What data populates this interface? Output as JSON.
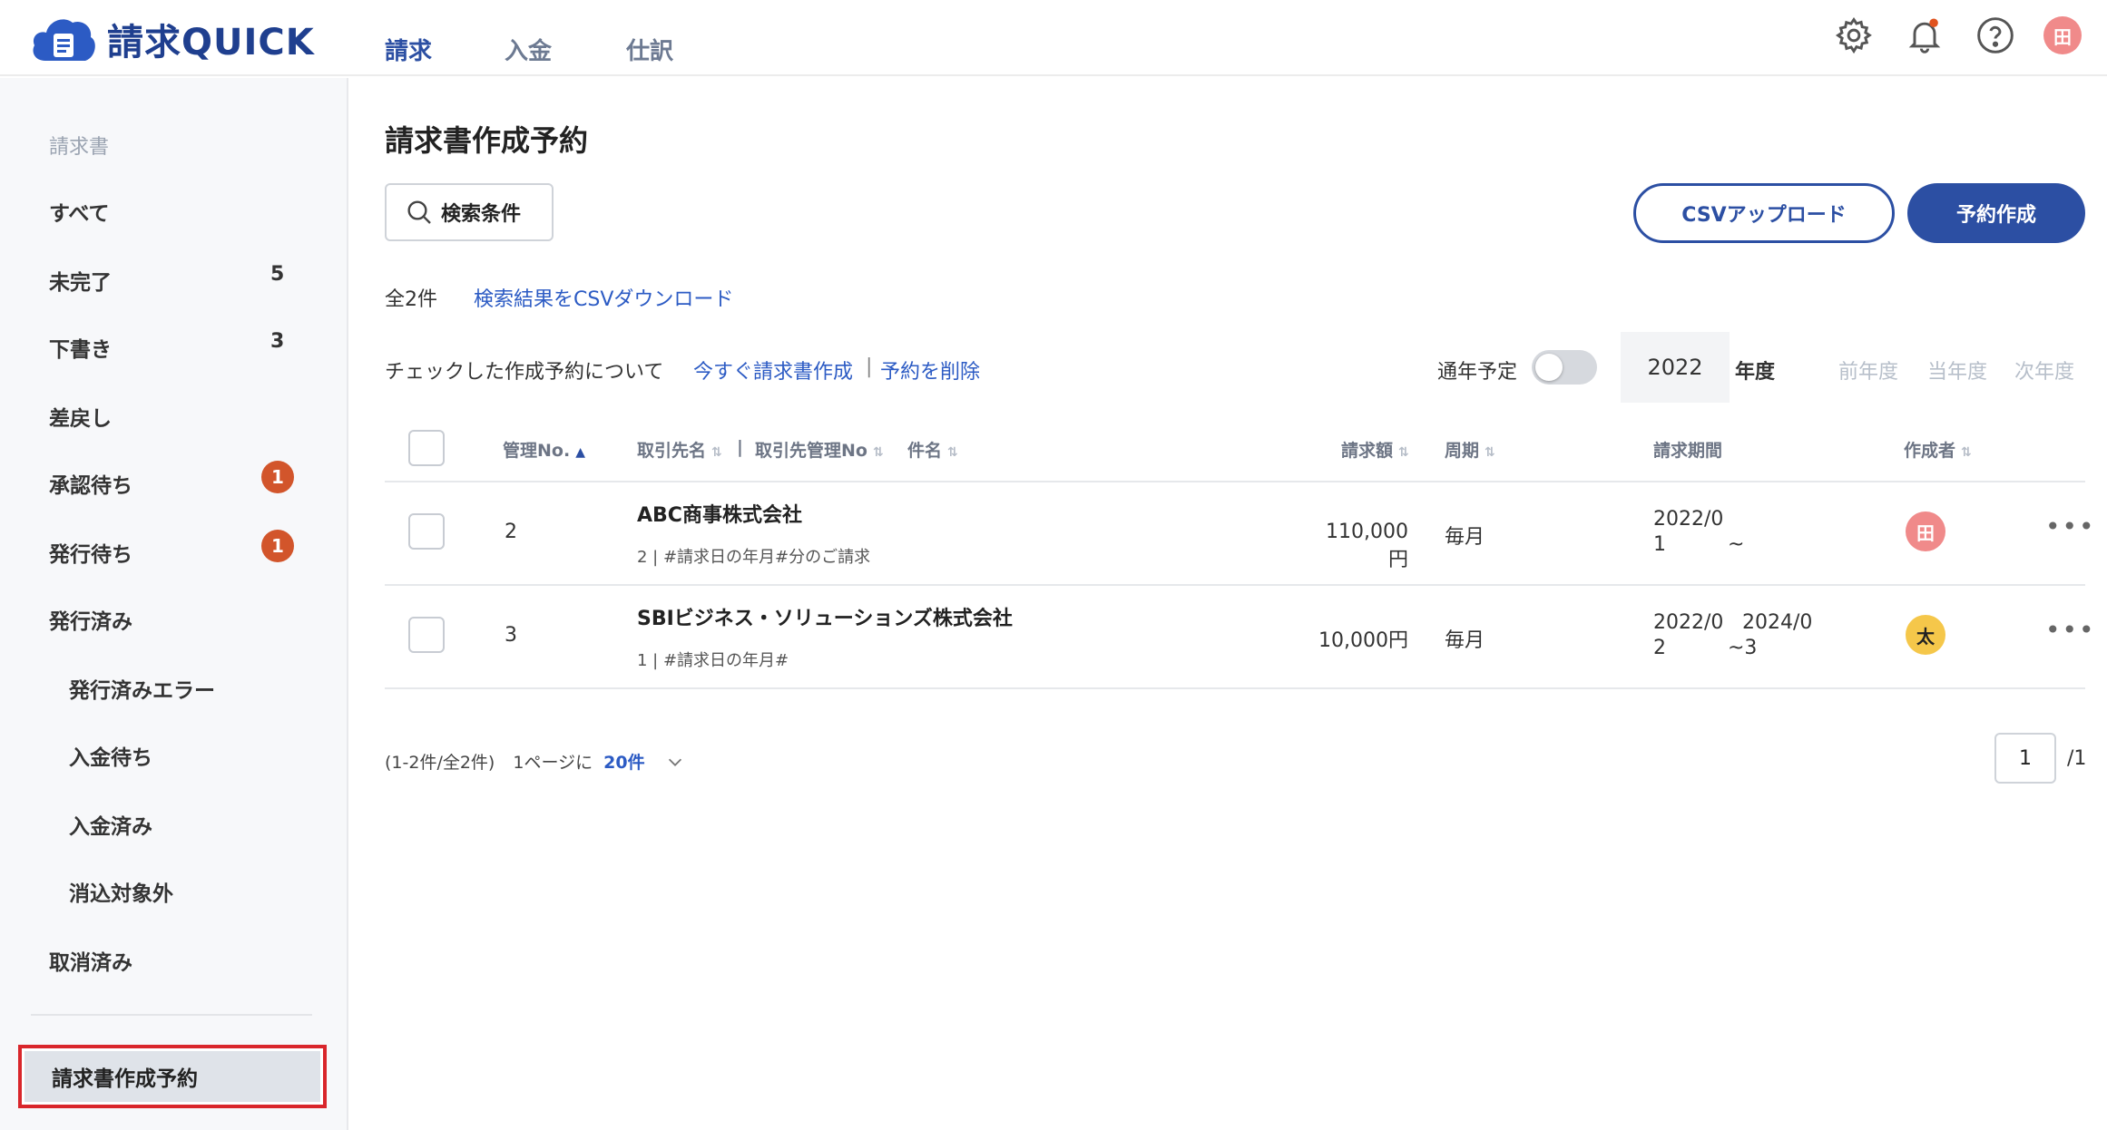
{
  "app": {
    "name": "請求QUICK"
  },
  "nav": {
    "tabs": [
      "請求",
      "入金",
      "仕訳"
    ],
    "active": 0
  },
  "header": {
    "user_initial": "田"
  },
  "sidebar": {
    "heading": "請求書",
    "items": [
      {
        "label": "すべて"
      },
      {
        "label": "未完了",
        "count": "5"
      },
      {
        "label": "下書き",
        "count": "3"
      },
      {
        "label": "差戻し"
      },
      {
        "label": "承認待ち",
        "badge": "1"
      },
      {
        "label": "発行待ち",
        "badge": "1"
      },
      {
        "label": "発行済み"
      }
    ],
    "subitems": [
      {
        "label": "発行済みエラー"
      },
      {
        "label": "入金待ち"
      },
      {
        "label": "入金済み"
      },
      {
        "label": "消込対象外"
      }
    ],
    "after_sub": {
      "label": "取消済み"
    },
    "active_item": {
      "label": "請求書作成予約"
    }
  },
  "main": {
    "title": "請求書作成予約",
    "search_label": "検索条件",
    "csv_upload": "CSVアップロード",
    "create_button": "予約作成",
    "count_text": "全2件",
    "csv_download": "検索結果をCSVダウンロード",
    "bulk_label": "チェックした作成予約について",
    "bulk_create": "今すぐ請求書作成",
    "bulk_sep": "|",
    "bulk_delete": "予約を削除",
    "yearly_label": "通年予定",
    "year": "2022",
    "year_suffix": "年度",
    "prev_year": "前年度",
    "current_year": "当年度",
    "next_year": "次年度"
  },
  "table": {
    "headers": {
      "no": "管理No.",
      "client": "取引先名",
      "sep": "|",
      "client_no": "取引先管理No",
      "subject": "件名",
      "amount": "請求額",
      "cycle": "周期",
      "period": "請求期間",
      "author": "作成者"
    },
    "rows": [
      {
        "no": "2",
        "client": "ABC商事株式会社",
        "sub": "2 | #請求日の年月#分のご請求",
        "amount": "110,000円",
        "cycle": "毎月",
        "start_a": "2022/0",
        "start_b": "1",
        "end_a": "",
        "end_b": "~",
        "author": "田",
        "author_color": "#f08a8a"
      },
      {
        "no": "3",
        "client": "SBIビジネス・ソリューションズ株式会社",
        "sub": "1 | #請求日の年月#",
        "amount": "10,000円",
        "cycle": "毎月",
        "start_a": "2022/0",
        "start_b": "2",
        "end_a": "2024/0",
        "end_b": "~3",
        "author": "太",
        "author_color": "#f5c74a"
      }
    ]
  },
  "pager": {
    "range": "(1-2件/全2件)",
    "per_page_label": "1ページに",
    "per_page": "20件",
    "page": "1",
    "total_pages": "/1"
  },
  "colors": {
    "brand": "#2c4fa3",
    "badge": "#d2552b",
    "highlight": "#d9262b"
  }
}
